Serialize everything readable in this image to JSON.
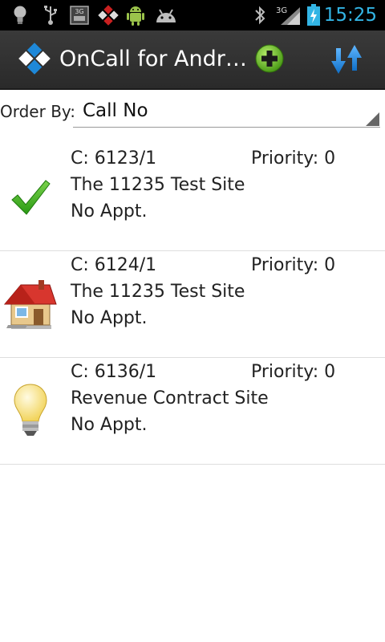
{
  "status_bar": {
    "time": "15:25",
    "icons": [
      "bulb-icon",
      "usb-icon",
      "3g-data-icon",
      "app-notify-icon",
      "android-icon",
      "android-debug-icon",
      "bluetooth-icon",
      "signal-3g-icon",
      "battery-charging-icon"
    ],
    "network_label": "3G"
  },
  "action_bar": {
    "title": "OnCall for Andr…",
    "icons": [
      "oncall-logo-icon",
      "add-icon",
      "sort-icon"
    ]
  },
  "order_by": {
    "label": "Order By:",
    "value": "Call No"
  },
  "calls": [
    {
      "call_no": "C: 6123/1",
      "priority": "Priority: 0",
      "site": "The 11235 Test Site",
      "appointment": "No Appt.",
      "icon": "checkmark-icon"
    },
    {
      "call_no": "C: 6124/1",
      "priority": "Priority: 0",
      "site": "The 11235 Test Site",
      "appointment": "No Appt.",
      "icon": "house-icon"
    },
    {
      "call_no": "C: 6136/1",
      "priority": "Priority: 0",
      "site": "Revenue Contract Site",
      "appointment": "No Appt.",
      "icon": "lightbulb-icon"
    }
  ],
  "colors": {
    "status_time": "#33b5e5",
    "action_bar": "#333333",
    "check_green": "#3cb21e",
    "add_green": "#6cc22a",
    "sort_blue": "#1e8de6"
  }
}
